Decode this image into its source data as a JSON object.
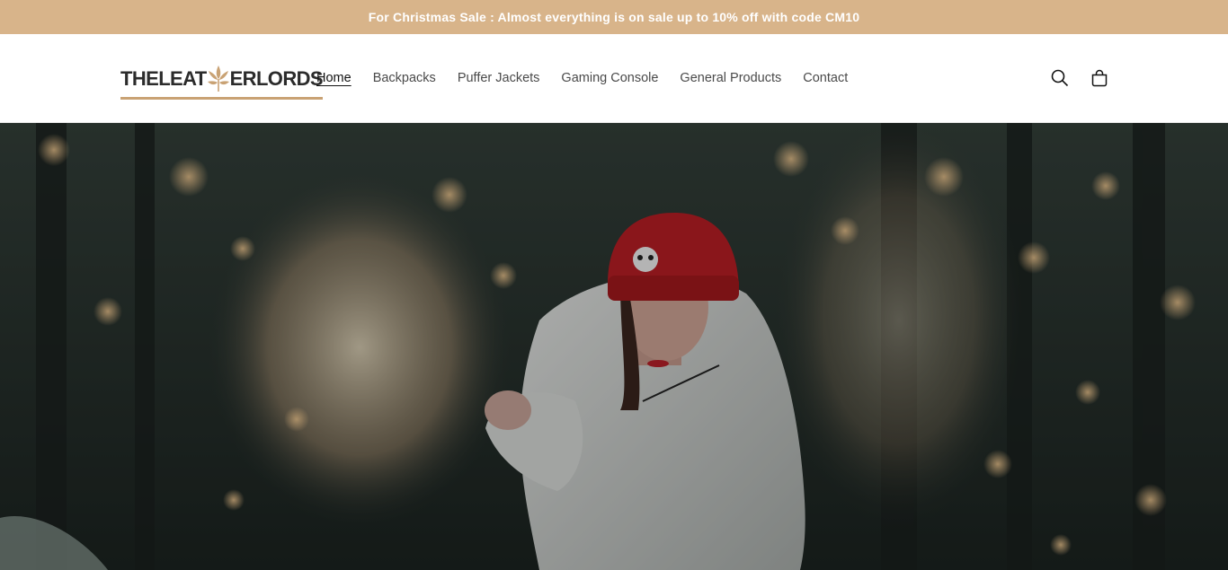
{
  "announcement": {
    "text": "For Christmas Sale : Almost everything is on sale up to 10% off with code CM10",
    "background": "#d8b48a"
  },
  "logo": {
    "left": "THELEAT",
    "right": "ERLORDS",
    "accent": "#c9a274"
  },
  "nav": {
    "items": [
      {
        "label": "Home",
        "active": true
      },
      {
        "label": "Backpacks"
      },
      {
        "label": "Puffer Jackets"
      },
      {
        "label": "Gaming Console"
      },
      {
        "label": "General Products"
      },
      {
        "label": "Contact"
      }
    ]
  },
  "icons": {
    "search": "search-icon",
    "cart": "cart-icon"
  },
  "hero": {
    "overlay": "#1a1f1d"
  }
}
